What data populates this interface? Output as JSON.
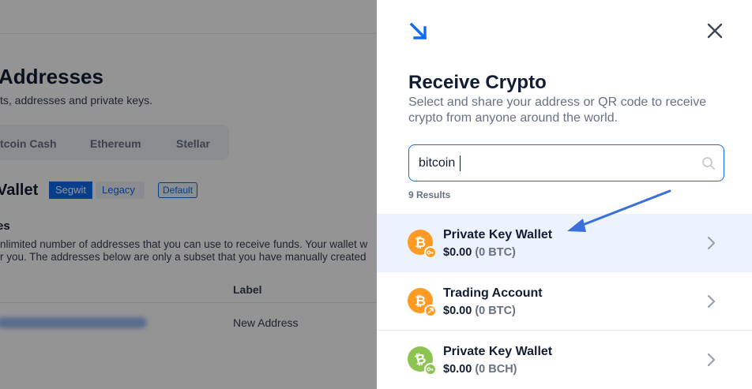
{
  "background": {
    "title": "Addresses",
    "subtitle": "ts, addresses and private keys.",
    "tabs": [
      "tcoin Cash",
      "Ethereum",
      "Stellar"
    ],
    "wallet_title": "Vallet",
    "address_type_segments": [
      "Segwit",
      "Legacy"
    ],
    "default_badge": "Default",
    "section_title": "es",
    "paragraph_lines": [
      "nlimited number of addresses that you can use to receive funds. Your wallet w",
      "r you. The addresses below are only a subset that you have manually created"
    ],
    "table_header_label": "Label",
    "row_label": "New Address"
  },
  "drawer": {
    "title": "Receive Crypto",
    "description": "Select and share your address or QR code to receive crypto from anyone around the world.",
    "search": {
      "value": "bitcoin",
      "placeholder": ""
    },
    "results_count": "9 Results",
    "wallets": [
      {
        "name": "Private Key Wallet",
        "amount": "$0.00",
        "crypto": "(0 BTC)",
        "icon": "bitcoin-key-icon",
        "color": "#ff9b22",
        "selected": true
      },
      {
        "name": "Trading Account",
        "amount": "$0.00",
        "crypto": "(0 BTC)",
        "icon": "bitcoin-trading-icon",
        "color": "#ff9b22",
        "selected": false
      },
      {
        "name": "Private Key Wallet",
        "amount": "$0.00",
        "crypto": "(0 BCH)",
        "icon": "bitcoin-cash-key-icon",
        "color": "#8dc351",
        "selected": false
      }
    ]
  },
  "colors": {
    "accent": "#0c6cf2",
    "bitcoin": "#ff9b22",
    "bitcoin_cash": "#8dc351",
    "annotation": "#3b6fd9"
  }
}
